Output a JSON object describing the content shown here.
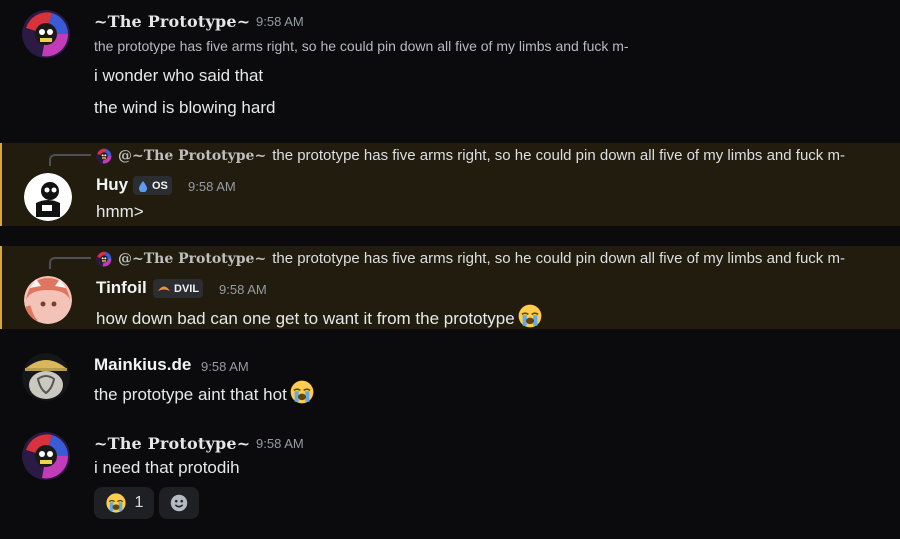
{
  "messages": [
    {
      "author": "~The Prototype~",
      "time": "9:58 AM",
      "lines": [
        "the prototype has five arms right, so he could pin down all five of my limbs and fuck m-",
        "i wonder who said that",
        "the wind is blowing hard"
      ]
    },
    {
      "reply_author": "@~The Prototype~",
      "reply_text": "the prototype has five arms right, so he could pin down all five of my limbs and fuck m-",
      "author": "Huy",
      "tag": "OS",
      "time": "9:58 AM",
      "text": "hmm>"
    },
    {
      "reply_author": "@~The Prototype~",
      "reply_text": "the prototype has five arms right, so he could pin down all five of my limbs and fuck m-",
      "author": "Tinfoil",
      "tag": "DVIL",
      "time": "9:58 AM",
      "text": "how down bad can one get to want it from the prototype"
    },
    {
      "author": "Mainkius.de",
      "time": "9:58 AM",
      "text": "the prototype aint that hot"
    },
    {
      "author": "~The Prototype~",
      "time": "9:58 AM",
      "text": "i need that protodih",
      "reactions": [
        {
          "emoji": "sob-emoji",
          "count": "1"
        },
        {
          "emoji": "add-reaction-icon",
          "count": ""
        }
      ]
    }
  ],
  "colors": {
    "background": "#0b0b0d",
    "mention_highlight": "#221c0e",
    "mention_bar": "#d6a83b",
    "timestamp": "#949ba4"
  }
}
